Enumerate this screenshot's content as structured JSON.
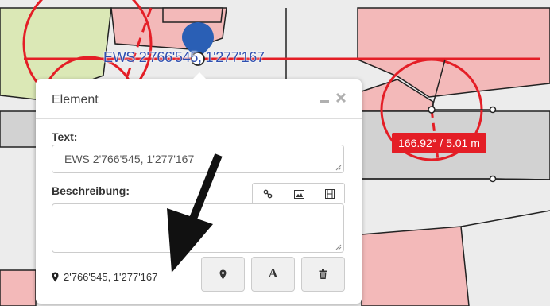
{
  "map": {
    "marker_label": "EWS 2'766'545, 1'277'167",
    "measurement": "166.92° / 5.01 m",
    "icons": [
      "location-pin-icon",
      "vertex-handle-icon"
    ],
    "colors": {
      "parcel_fill": "#f3b9b9",
      "meadow_fill": "#dbe8b6",
      "road_fill": "#d2d2d2",
      "ground_fill": "#ececec",
      "measure_red": "#e41e26",
      "marker_blue": "#2a5fb5"
    }
  },
  "popup": {
    "title": "Element",
    "text_label": "Text:",
    "text_value": "EWS 2'766'545, 1'277'167",
    "description_label": "Beschreibung:",
    "description_value": "",
    "coordinates": "2'766'545, 1'277'167",
    "icons": {
      "minimize": "minimize-icon",
      "close": "close-icon",
      "link": "link-icon",
      "image": "image-icon",
      "video": "film-icon",
      "location": "map-marker-icon",
      "label": "A",
      "delete": "trash-icon"
    }
  }
}
